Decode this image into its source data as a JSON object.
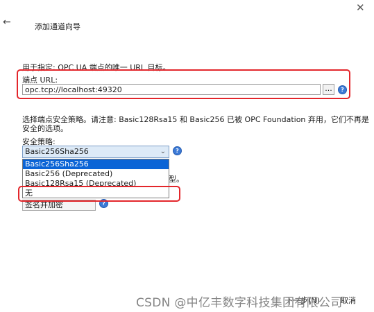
{
  "window": {
    "close_glyph": "✕",
    "back_glyph": "←",
    "title": "添加通道向导"
  },
  "endpoint": {
    "description": "用于指定: OPC UA 端点的唯一 URL 目标。",
    "label": "端点 URL:",
    "url_value": "opc.tcp://localhost:49320",
    "browse_label": "..."
  },
  "security": {
    "description_line1": "选择端点安全策略。请注意: Basic128Rsa15 和 Basic256 已被 OPC Foundation 弃用，它们不再是",
    "description_line2": "安全的选项。",
    "label": "安全策略:",
    "selected_value": "Basic256Sha256",
    "options": [
      "Basic256Sha256",
      "Basic256 (Deprecated)",
      "Basic128Rsa15 (Deprecated)",
      "无"
    ]
  },
  "message_mode": {
    "partial_label": "型。",
    "selected_value": "签名并加密"
  },
  "footer": {
    "next_label": "下一步(N)",
    "cancel_label": "取消"
  },
  "watermark": "CSDN @中亿丰数字科技集团有限公司",
  "colors": {
    "highlight": "#e3262b",
    "selection": "#0a64d6",
    "help_icon": "#3c7ad6"
  }
}
